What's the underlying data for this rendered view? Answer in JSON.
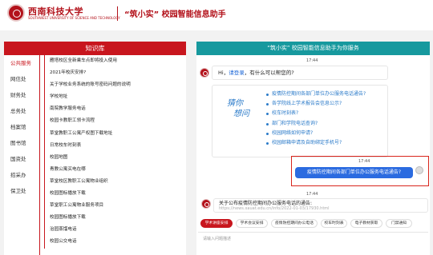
{
  "header": {
    "school_name": "西南科技大学",
    "school_sub": "SOUTHWEST UNIVERSITY OF SCIENCE AND TECHNOLOGY",
    "app_title": "“筑小实” 校园智能信息助手"
  },
  "knowledge": {
    "title": "知识库",
    "categories": [
      "公共服务",
      "网信处",
      "财务处",
      "总务处",
      "档案馆",
      "图书馆",
      "国资处",
      "招采办",
      "保卫处"
    ],
    "topics": [
      "雁塔校区全新乘车点即将投入使用",
      "2021年校庆安排?",
      "关于学校业务系统的账号密码问题的说明",
      "学校地址",
      "南院教学服务电话",
      "校园卡教职工领卡流程",
      "草堂教职工公寓产权图下载地址",
      "日常校车时刻表",
      "校园地图",
      "青教公寓买电在哪",
      "草堂校区教职工公寓物业组织",
      "校园图标播放下载",
      "草堂职工公寓物业服务项目",
      "校园图标播放下载",
      "治园蒸馏电话",
      "校园公交电话"
    ]
  },
  "chat": {
    "title": "“筑小实” 校园智能信息助手为你服务",
    "timestamps": [
      "17:44",
      "17:44",
      "17:44"
    ],
    "greeting_prefix": "Hi，",
    "greeting_link": "请登录",
    "greeting_suffix": "，有什么可以帮您的?",
    "guess_label_1": "猜你",
    "guess_label_2": "想问",
    "guesses": [
      "疫情防控期间各部门单位办公服务电话通告?",
      "各学院线上学术报告会信息公示?",
      "校车时刻表?",
      "部门和学院电话查询?",
      "校园网络如何申请?",
      "校园邮箱申请及自助绑定手机号?"
    ],
    "user_message": "疫情防控期间各部门单位办公服务电话通告?",
    "reply_text": "关于公布疫情防控期间办公服务电话的通告:",
    "reply_link": "https://news.xauat.edu.cn/info/2022-01-03/17930.html"
  },
  "quick_actions": [
    "学术讲座安排",
    "学术会议安排",
    "疫情防控期间办公电话",
    "校车时刻表",
    "电子教材获取",
    "门禁通知"
  ],
  "input": {
    "placeholder": "请输入问题描述"
  },
  "colors": {
    "brand_red": "#c8161e",
    "teal": "#17999e",
    "link_blue": "#2a7ac9",
    "user_bubble": "#2b6be0"
  }
}
